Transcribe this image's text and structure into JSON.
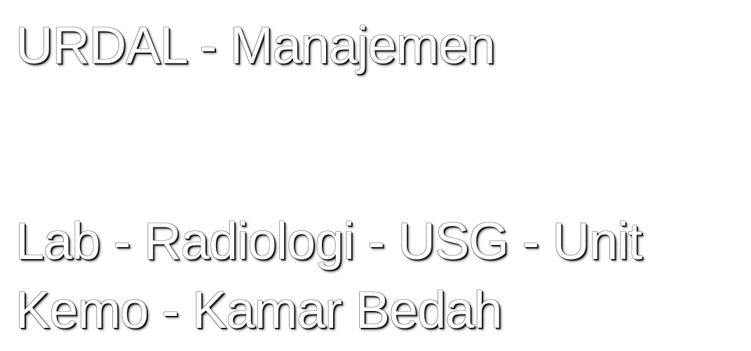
{
  "slide": {
    "title": "URDAL - Manajemen",
    "body_line_1": "Lab - Radiologi - USG - Unit",
    "body_line_2": "Kemo - Kamar Bedah"
  }
}
